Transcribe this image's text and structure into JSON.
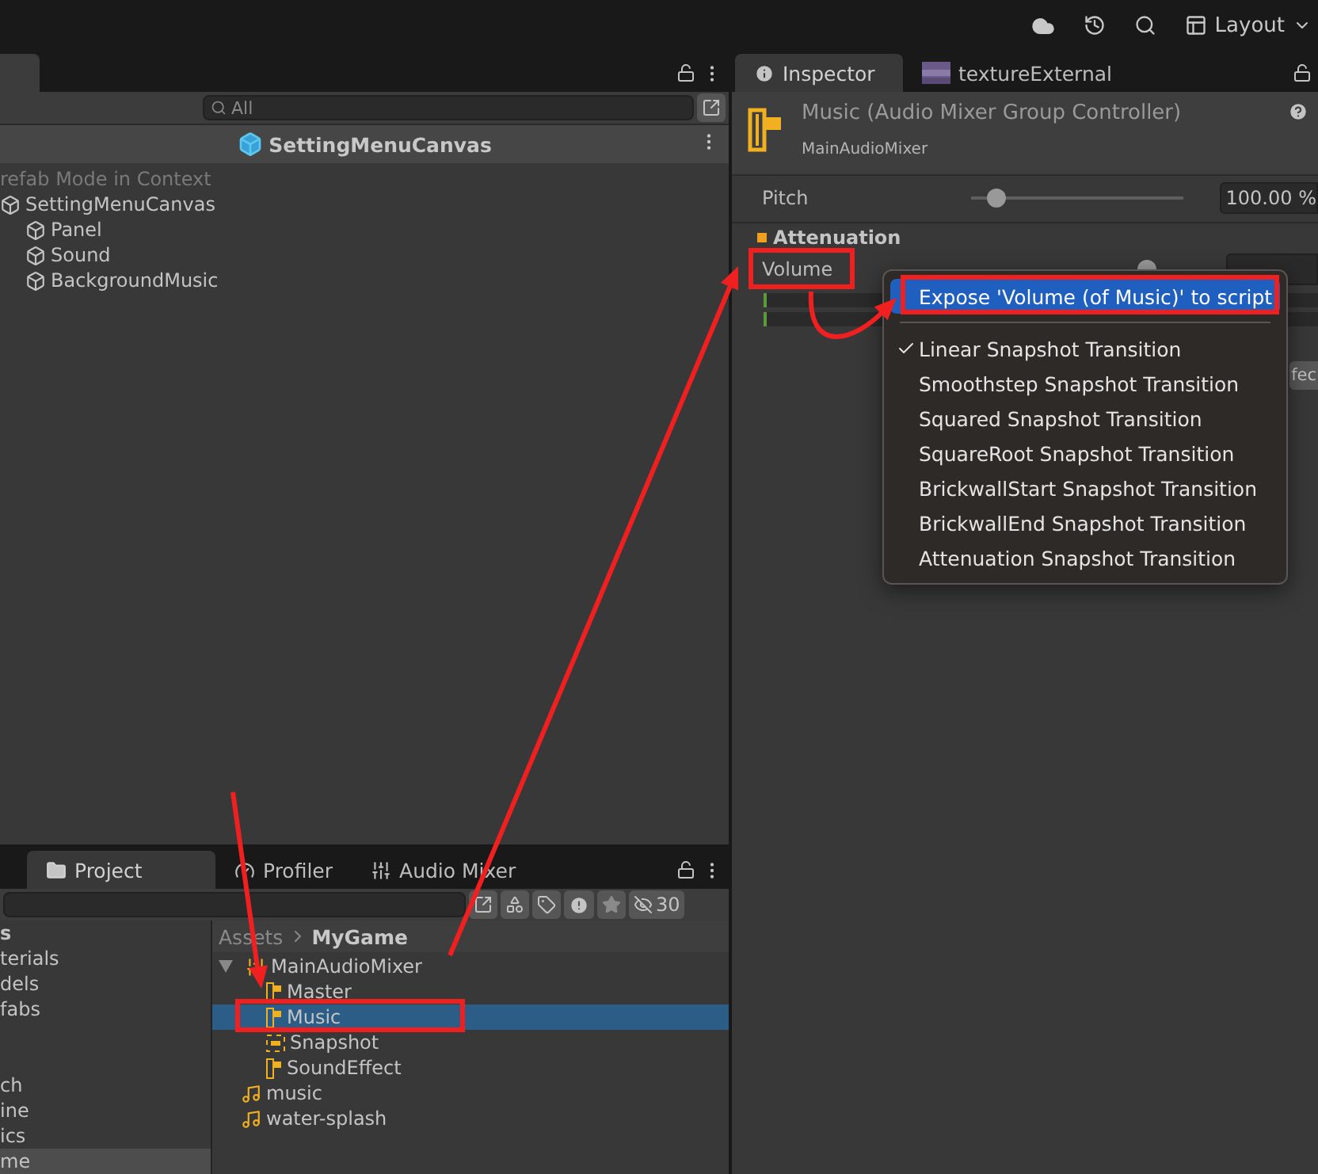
{
  "toolbar": {
    "layout_label": "Layout"
  },
  "hierarchy": {
    "search_placeholder": "All",
    "header": "SettingMenuCanvas",
    "context_label": "refab Mode in Context",
    "tree": [
      {
        "label": "SettingMenuCanvas",
        "children": [
          {
            "label": "Panel"
          },
          {
            "label": "Sound"
          },
          {
            "label": "BackgroundMusic"
          }
        ]
      }
    ]
  },
  "project": {
    "tabs": [
      {
        "label": "Project",
        "kind": "folder",
        "selected": true
      },
      {
        "label": "Profiler",
        "kind": "gauge",
        "selected": false
      },
      {
        "label": "Audio Mixer",
        "kind": "mixer",
        "selected": false
      }
    ],
    "filter_count": "30",
    "folders": [
      {
        "label": "s",
        "bold": true,
        "selected": false
      },
      {
        "label": "terials",
        "bold": false,
        "selected": false
      },
      {
        "label": "dels",
        "bold": false,
        "selected": false
      },
      {
        "label": "fabs",
        "bold": false,
        "selected": false
      },
      {
        "label": "ch",
        "bold": false,
        "selected": false
      },
      {
        "label": "ine",
        "bold": false,
        "selected": false
      },
      {
        "label": "ics",
        "bold": false,
        "selected": false
      },
      {
        "label": "me",
        "bold": false,
        "selected": true
      }
    ],
    "breadcrumb": [
      "Assets",
      "MyGame"
    ],
    "assets": [
      {
        "label": "MainAudioMixer",
        "kind": "mixer",
        "expanded": true,
        "selected": false,
        "children": [
          {
            "label": "Master",
            "kind": "group",
            "selected": false
          },
          {
            "label": "Music",
            "kind": "group",
            "selected": true
          },
          {
            "label": "Snapshot",
            "kind": "snapshot",
            "selected": false
          },
          {
            "label": "SoundEffect",
            "kind": "group",
            "selected": false
          }
        ]
      },
      {
        "label": "music",
        "kind": "audio",
        "selected": false
      },
      {
        "label": "water-splash",
        "kind": "audio",
        "selected": false
      }
    ]
  },
  "inspector": {
    "tabs": [
      {
        "label": "Inspector",
        "kind": "info",
        "selected": true
      },
      {
        "label": "textureExternal",
        "kind": "texture",
        "selected": false
      }
    ],
    "title": "Music (Audio Mixer Group Controller)",
    "subtitle": "MainAudioMixer",
    "pitch": {
      "label": "Pitch",
      "level": 0.12,
      "value": "100.00 %"
    },
    "section": "Attenuation",
    "volume": {
      "label": "Volume"
    },
    "effect_button": "fec"
  },
  "context_menu": {
    "items": [
      {
        "label": "Expose 'Volume (of Music)' to script",
        "kind": "action",
        "selected": true,
        "checked": false
      },
      {
        "label": "Linear Snapshot Transition",
        "kind": "option",
        "selected": false,
        "checked": true
      },
      {
        "label": "Smoothstep Snapshot Transition",
        "kind": "option",
        "selected": false,
        "checked": false
      },
      {
        "label": "Squared Snapshot Transition",
        "kind": "option",
        "selected": false,
        "checked": false
      },
      {
        "label": "SquareRoot Snapshot Transition",
        "kind": "option",
        "selected": false,
        "checked": false
      },
      {
        "label": "BrickwallStart Snapshot Transition",
        "kind": "option",
        "selected": false,
        "checked": false
      },
      {
        "label": "BrickwallEnd Snapshot Transition",
        "kind": "option",
        "selected": false,
        "checked": false
      },
      {
        "label": "Attenuation Snapshot Transition",
        "kind": "option",
        "selected": false,
        "checked": false
      }
    ]
  }
}
